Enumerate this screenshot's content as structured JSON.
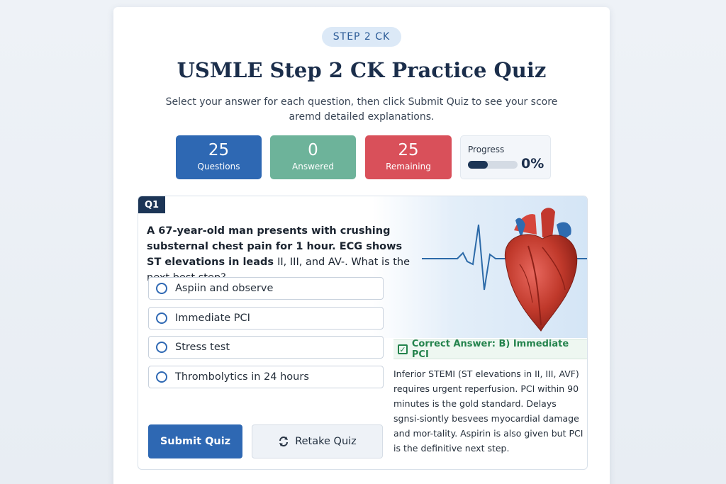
{
  "header": {
    "badge": "STEP 2 CK",
    "title": "USMLE Step 2 CK Practice Quiz",
    "subtitle": "Select your answer for each question, then click Submit Quiz to see your score aremd detailed explanations."
  },
  "stats": [
    {
      "value": "25",
      "label": "Questions",
      "color": "#2e68b3"
    },
    {
      "value": "0",
      "label": "Answered",
      "color": "#6db39a"
    },
    {
      "value": "25",
      "label": "Remaining",
      "color": "#d9505a"
    }
  ],
  "progress": {
    "label": "Progress",
    "value": "0%"
  },
  "question": {
    "tag": "Q1",
    "text_bold": "A 67-year-old man presents with crushing substernal chest pain for 1 hour. ECG shows ST elevations in leads",
    "text_light": "II, III, and AV-. What is the next best step?",
    "options": [
      "Aspiin and observe",
      "Immediate PCI",
      "Stress test",
      "Thrombolytics in 24 hours"
    ]
  },
  "buttons": {
    "submit": "Submit Quiz",
    "retake": "Retake Quiz"
  },
  "answer": {
    "correct": "Correct Answer: B) Immediate PCI",
    "explanation": "Inferior STEMI (ST elevations in II, III, AVF) requires urgent reperfusion. PCI within 90 minutes is the gold standard. Delays sgnsi-siontly besvees myocardial damage and mor-tality. Aspirin is also given but PCI is the definitive next step."
  },
  "icons": {
    "retake": "refresh-icon",
    "correct": "checkbox-icon",
    "hero": "heart-ecg-illustration"
  }
}
